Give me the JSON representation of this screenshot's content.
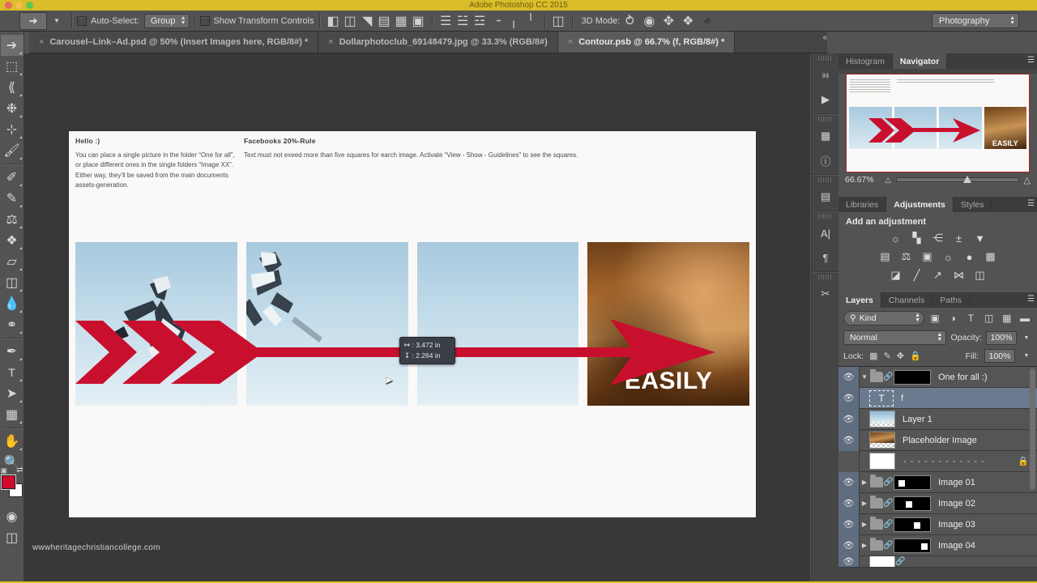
{
  "window": {
    "app_title": "Adobe Photoshop CC 2015",
    "traffic_lights": [
      "close",
      "minimize",
      "zoom"
    ]
  },
  "options_bar": {
    "move_tool_icon": "move-tool-icon",
    "auto_select_label": "Auto-Select:",
    "auto_select_value": "Group",
    "show_transform_label": "Show Transform Controls",
    "align_icons": [
      "align-left-edges-icon",
      "align-horizontal-centers-icon",
      "align-right-edges-icon",
      "align-top-edges-icon",
      "align-vertical-centers-icon",
      "align-bottom-edges-icon"
    ],
    "distribute_icons": [
      "distribute-top-edges-icon",
      "distribute-vertical-centers-icon",
      "distribute-bottom-edges-icon",
      "distribute-left-edges-icon",
      "distribute-horizontal-centers-icon",
      "distribute-right-edges-icon"
    ],
    "auto_align_icon": "auto-align-layers-icon",
    "mode_3d_label": "3D Mode:",
    "mode_3d_icons": [
      "rotate-3d-icon",
      "roll-3d-icon",
      "pan-3d-icon",
      "slide-3d-icon",
      "scale-3d-icon"
    ],
    "workspace_value": "Photography"
  },
  "tabs": [
    {
      "label": "Carousel–Link–Ad.psd @ 50% (Insert Images here, RGB/8#) *",
      "active": false,
      "close": "×"
    },
    {
      "label": "Dollarphotoclub_69148479.jpg @ 33.3% (RGB/8#)",
      "active": false,
      "close": "×"
    },
    {
      "label": "Contour.psb @ 66.7% (f, RGB/8#) *",
      "active": true,
      "close": "×"
    }
  ],
  "toolbar": {
    "tools": [
      {
        "name": "move-tool",
        "glyph": "↖",
        "selected": true,
        "has_flyout": true
      },
      {
        "name": "rectangular-marquee-tool",
        "glyph": "⬚",
        "selected": false,
        "has_flyout": true
      },
      {
        "name": "lasso-tool",
        "glyph": "⌖",
        "selected": false,
        "has_flyout": true
      },
      {
        "name": "magic-wand-tool",
        "glyph": "✹",
        "selected": false,
        "has_flyout": true
      },
      {
        "name": "crop-tool",
        "glyph": "⊡",
        "selected": false,
        "has_flyout": true
      },
      {
        "name": "eyedropper-tool",
        "glyph": "✒",
        "selected": false,
        "has_flyout": true
      },
      {
        "name": "spot-healing-brush-tool",
        "glyph": "✐",
        "selected": false,
        "has_flyout": true
      },
      {
        "name": "brush-tool",
        "glyph": "✎",
        "selected": false,
        "has_flyout": true
      },
      {
        "name": "clone-stamp-tool",
        "glyph": "⚲",
        "selected": false,
        "has_flyout": true
      },
      {
        "name": "history-brush-tool",
        "glyph": "❀",
        "selected": false,
        "has_flyout": true
      },
      {
        "name": "eraser-tool",
        "glyph": "▱",
        "selected": false,
        "has_flyout": true
      },
      {
        "name": "gradient-tool",
        "glyph": "◩",
        "selected": false,
        "has_flyout": true
      },
      {
        "name": "blur-tool",
        "glyph": "◖",
        "selected": false,
        "has_flyout": true
      },
      {
        "name": "dodge-tool",
        "glyph": "⚶",
        "selected": false,
        "has_flyout": true
      },
      {
        "name": "pen-tool",
        "glyph": "✑",
        "selected": false,
        "has_flyout": true
      },
      {
        "name": "horizontal-type-tool",
        "glyph": "T",
        "selected": false,
        "has_flyout": true
      },
      {
        "name": "path-selection-tool",
        "glyph": "➤",
        "selected": false,
        "has_flyout": true
      },
      {
        "name": "rectangle-tool",
        "glyph": "▣",
        "selected": false,
        "has_flyout": true
      },
      {
        "name": "hand-tool",
        "glyph": "✋",
        "selected": false,
        "has_flyout": true
      },
      {
        "name": "zoom-tool",
        "glyph": "⌕",
        "selected": false,
        "has_flyout": false
      }
    ],
    "foreground_color": "#cf0a2c",
    "background_color": "#ffffff",
    "swap_colors_icon": "swap-colors-icon",
    "default_colors_icon": "default-colors-icon",
    "quick_mask_icon": "quick-mask-mode-icon",
    "screen_mode_icon": "screen-mode-icon"
  },
  "canvas": {
    "doc_heading_1": "Hello :)",
    "doc_body_1": "You can place a single picture in the folder “One for all”, or place different ones in the single folders “Image XX”. Either way, they’ll be saved from the main documents assets-generation.",
    "doc_heading_2": "Facebooks 20%-Rule",
    "doc_body_2": "Text must not exeed more than five squares for earch image. Activate “View - Show - Guidelines” to see the squares.",
    "easily_text": "EASILY",
    "arrow_color": "#c8102e",
    "watermark": "wwwheritagechristiancollege.com",
    "measure_tooltip": {
      "width_icon": "width-measure-icon",
      "width_value": "3.472 in",
      "height_icon": "height-measure-icon",
      "height_value": "2.264 in"
    },
    "cursor_icon": "mouse-pointer-icon"
  },
  "icon_dock": {
    "items": [
      "history-panel-icon",
      "actions-panel-icon",
      "properties-panel-icon",
      "info-panel-icon",
      "layer-comps-panel-icon",
      "character-panel-icon",
      "paragraph-panel-icon",
      "tool-presets-panel-icon"
    ]
  },
  "navigator_panel": {
    "tabs": [
      {
        "label": "Histogram",
        "active": false
      },
      {
        "label": "Navigator",
        "active": true
      }
    ],
    "menu_icon": "panel-menu-icon",
    "zoom_value": "66.67%",
    "zoom_out_icon": "zoom-out-icon",
    "zoom_in_icon": "zoom-in-icon",
    "thumb_easily_text": "EASILY"
  },
  "adjustments_panel": {
    "tabs": [
      {
        "label": "Libraries",
        "active": false
      },
      {
        "label": "Adjustments",
        "active": true
      },
      {
        "label": "Styles",
        "active": false
      }
    ],
    "menu_icon": "panel-menu-icon",
    "title": "Add an adjustment",
    "rows": [
      [
        "brightness-contrast-icon",
        "levels-icon",
        "curves-icon",
        "exposure-icon",
        "vibrance-icon"
      ],
      [
        "hue-saturation-icon",
        "color-balance-icon",
        "black-and-white-icon",
        "photo-filter-icon",
        "channel-mixer-icon",
        "color-lookup-icon"
      ],
      [
        "invert-icon",
        "posterize-icon",
        "threshold-icon",
        "gradient-map-icon",
        "selective-color-icon"
      ]
    ],
    "glyphs": {
      "brightness-contrast-icon": "☀",
      "levels-icon": "▒",
      "curves-icon": "⌲",
      "exposure-icon": "±",
      "vibrance-icon": "▽",
      "hue-saturation-icon": "▤",
      "color-balance-icon": "⚖",
      "black-and-white-icon": "◑",
      "photo-filter-icon": "◔",
      "channel-mixer-icon": "✿",
      "color-lookup-icon": "⊞",
      "invert-icon": "◨",
      "posterize-icon": "▨",
      "threshold-icon": "◧",
      "gradient-map-icon": "⋈",
      "selective-color-icon": "◫"
    }
  },
  "layers_panel": {
    "tabs": [
      {
        "label": "Layers",
        "active": true
      },
      {
        "label": "Channels",
        "active": false
      },
      {
        "label": "Paths",
        "active": false
      }
    ],
    "menu_icon": "panel-menu-icon",
    "filter_kind_label": "Kind",
    "filter_search_icon": "search-icon",
    "filter_icons": [
      "filter-pixel-layers-icon",
      "filter-adjustment-layers-icon",
      "filter-type-layers-icon",
      "filter-shape-layers-icon",
      "filter-smart-object-layers-icon",
      "filter-toggle-icon"
    ],
    "blend_mode": "Normal",
    "opacity_label": "Opacity:",
    "opacity_value": "100%",
    "lock_label": "Lock:",
    "lock_icons": [
      "lock-transparent-pixels-icon",
      "lock-image-pixels-icon",
      "lock-position-icon",
      "lock-all-icon"
    ],
    "fill_label": "Fill:",
    "fill_value": "100%",
    "layers": [
      {
        "name": "One for all :)",
        "type": "group",
        "visible": true,
        "selected": false,
        "expanded": true,
        "linked": true,
        "mask": "black-full"
      },
      {
        "name": "f",
        "type": "text",
        "visible": true,
        "selected": true,
        "expanded": false,
        "linked": false,
        "mask": "none"
      },
      {
        "name": "Layer 1",
        "type": "pixel-sky",
        "visible": true,
        "selected": false,
        "expanded": false,
        "linked": false,
        "mask": "none"
      },
      {
        "name": "Placeholder Image",
        "type": "pixel-wood",
        "visible": true,
        "selected": false,
        "expanded": false,
        "linked": false,
        "mask": "none"
      },
      {
        "name": "- - - - - - - - - - - -",
        "type": "locked-background",
        "visible": false,
        "selected": false,
        "expanded": false,
        "linked": false,
        "mask": "white",
        "locked": true
      },
      {
        "name": "Image 01",
        "type": "group",
        "visible": true,
        "selected": false,
        "expanded": false,
        "linked": true,
        "mask": "black-left"
      },
      {
        "name": "Image 02",
        "type": "group",
        "visible": true,
        "selected": false,
        "expanded": false,
        "linked": true,
        "mask": "black-midleft"
      },
      {
        "name": "Image 03",
        "type": "group",
        "visible": true,
        "selected": false,
        "expanded": false,
        "linked": true,
        "mask": "black-midright"
      },
      {
        "name": "Image 04",
        "type": "group",
        "visible": true,
        "selected": false,
        "expanded": false,
        "linked": true,
        "mask": "black-right"
      }
    ],
    "eye_icon": "eye-icon",
    "expand_icon": "disclosure-triangle-icon",
    "link_icon": "link-icon",
    "lock_badge_icon": "lock-icon"
  }
}
